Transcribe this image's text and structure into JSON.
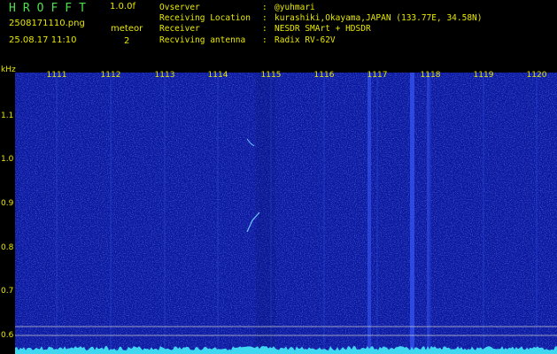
{
  "header": {
    "app_title": "HROFFT",
    "version": "1.0.0f",
    "filename": "2508171110.png",
    "datetime": "25.08.17 11:10",
    "meteor_label": "meteor",
    "meteor_count": "2",
    "info": [
      {
        "label": "Ovserver",
        "value": "@yuhmari"
      },
      {
        "label": "Receiving Location",
        "value": "kurashiki,Okayama,JAPAN (133.77E, 34.58N)"
      },
      {
        "label": "Receiver",
        "value": "NESDR SMArt + HDSDR"
      },
      {
        "label": "Recviving antenna",
        "value": "Radix RV-62V"
      }
    ]
  },
  "axes": {
    "y_unit": "kHz",
    "y_ticks": [
      "1.1",
      "1.0",
      "0.9",
      "0.8",
      "0.7",
      "0.6"
    ],
    "x_ticks": [
      "1111",
      "1112",
      "1113",
      "1114",
      "1115",
      "1116",
      "1117",
      "1118",
      "1119",
      "1120"
    ]
  },
  "colors": {
    "background": "#000000",
    "spectrogram": "#0a18a0",
    "label": "#e8e800",
    "title": "#4de04d",
    "noise_floor": "#3fd8f0"
  }
}
